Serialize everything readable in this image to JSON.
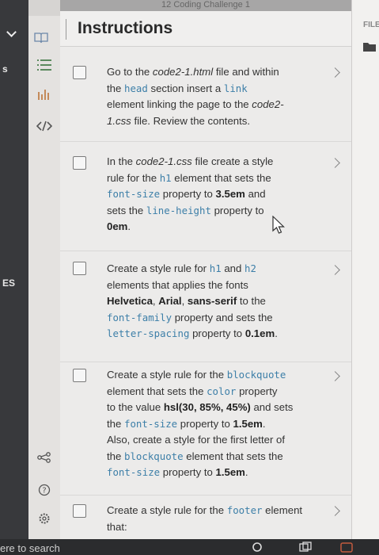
{
  "panel_top_text": "12 Coding Challenge 1",
  "header": {
    "title": "Instructions"
  },
  "left_fragments": {
    "a": "s",
    "b": "ES"
  },
  "right_panel": {
    "label": "FILE"
  },
  "bottom": {
    "search": "ere to search"
  },
  "icons": {
    "toolbar": [
      "book-icon",
      "list-icon",
      "chart-icon",
      "code-icon",
      "share-icon",
      "help-icon",
      "settings-icon"
    ],
    "right": [
      "folder-icon"
    ]
  },
  "colors": {
    "code": "#3d7fa8",
    "panel": "#ecebea",
    "dark": "#38393c"
  },
  "tasks": [
    {
      "line1_a": "Go to the ",
      "line1_b": "code2-1.html",
      "line1_c": " file and within",
      "line2_a": "the ",
      "line2_code1": "head",
      "line2_b": " section insert a ",
      "line2_code2": "link",
      "line3": "element linking the page to the ",
      "line3_i": "code2-",
      "line4_i": "1.css",
      "line4": " file. Review the contents."
    },
    {
      "line1_a": "In the ",
      "line1_i": "code2-1.css",
      "line1_b": " file create a style",
      "line2_a": "rule for the ",
      "line2_code": "h1",
      "line2_b": " element that sets the",
      "line3_code": "font-size",
      "line3_a": " property to ",
      "line3_bold": "3.5em",
      "line3_b": " and",
      "line4_a": "sets the ",
      "line4_code": "line-height",
      "line4_b": " property to",
      "line5_bold": "0em",
      "line5_b": "."
    },
    {
      "line1_a": "Create a style rule for ",
      "line1_code1": "h1",
      "line1_b": " and ",
      "line1_code2": "h2",
      "line2": "elements that applies the fonts",
      "line3_b1": "Helvetica",
      "line3_s1": ", ",
      "line3_b2": "Arial",
      "line3_s2": ", ",
      "line3_b3": "sans-serif",
      "line3_c": " to the",
      "line4_code": "font-family",
      "line4_a": " property and sets the",
      "line5_code": "letter-spacing",
      "line5_a": " property to ",
      "line5_bold": "0.1em",
      "line5_b": "."
    },
    {
      "line1_a": "Create a style rule for the ",
      "line1_code": "blockquote",
      "line2_a": "element that sets the ",
      "line2_code": "color",
      "line2_b": " property",
      "line3_a": "to the value ",
      "line3_bold": "hsl(30, 85%, 45%)",
      "line3_b": " and sets",
      "line4_a": "the ",
      "line4_code": "font-size",
      "line4_b": " property to ",
      "line4_bold": "1.5em",
      "line4_c": ".",
      "line5": "Also, create a style for the first letter of",
      "line6_a": "the ",
      "line6_code": "blockquote",
      "line6_b": " element that sets the",
      "line7_code": "font-size",
      "line7_a": " property to ",
      "line7_bold": "1.5em",
      "line7_b": "."
    },
    {
      "line1_a": "Create a style rule for the ",
      "line1_code": "footer",
      "line1_b": " element",
      "line2": "that:"
    }
  ]
}
